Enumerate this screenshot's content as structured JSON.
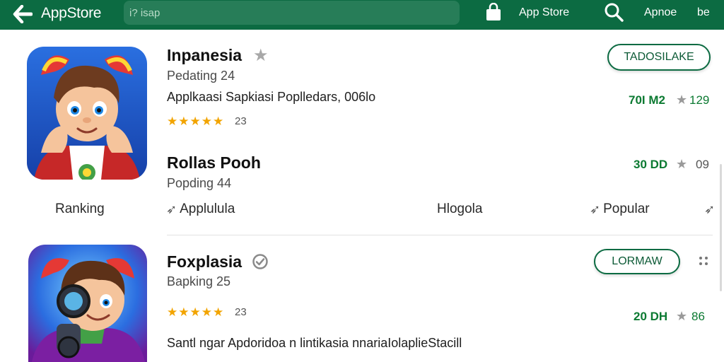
{
  "topbar": {
    "brand": "AppStore",
    "search_placeholder": "i? isap",
    "store_link": "App Store",
    "link2": "Apnoe",
    "link3": "be"
  },
  "apps": [
    {
      "title": "Inpanesia",
      "subtitle": "Pedating 24",
      "description": "Applkaasi Sapkiasi Poplledars, 006lo",
      "rating_count": "23",
      "button_label": "TADOSILAKE",
      "price": "70I M2",
      "count": "129"
    },
    {
      "title": "Rollas Pooh",
      "subtitle": "Popding 44",
      "price": "30 DD",
      "count": "09"
    },
    {
      "title": "Foxplasia",
      "subtitle": "Bapking 25",
      "rating_count": "23",
      "button_label": "LORMAW",
      "price": "20 DH",
      "count": "86",
      "description": "Santl ngar Apdoridoa n lintikasia nnariaIolaplieStacill"
    }
  ],
  "nav": {
    "ranking": "Ranking",
    "applulula": "Applulula",
    "hlogola": "Hlogola",
    "popular": "Popular"
  },
  "colors": {
    "topbar": "#0c6b42",
    "accent_green": "#0c7a32",
    "star": "#f2a400"
  }
}
